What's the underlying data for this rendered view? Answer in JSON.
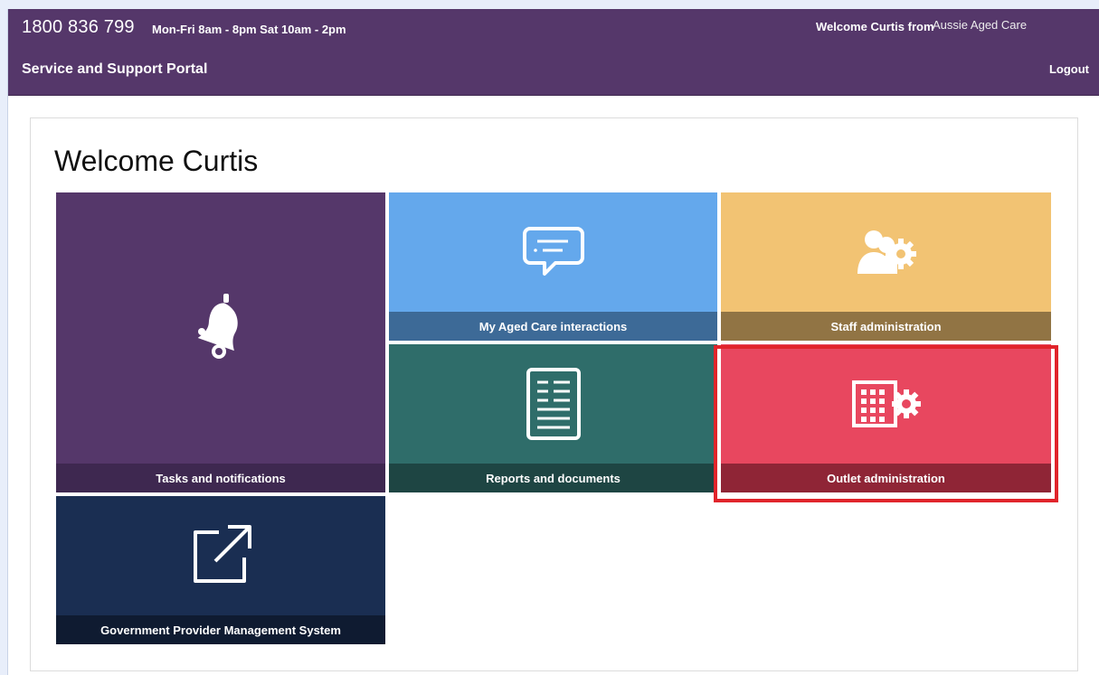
{
  "header": {
    "phone": "1800 836 799",
    "hours": "Mon-Fri 8am - 8pm Sat 10am - 2pm",
    "welcome_prefix": "Welcome Curtis from",
    "org_name": "Aussie Aged Care",
    "portal_title": "Service and Support Portal",
    "logout_label": "Logout"
  },
  "main": {
    "title": "Welcome Curtis",
    "tiles": [
      {
        "label": "Tasks and notifications",
        "icon": "bell-icon",
        "color": "#55376a"
      },
      {
        "label": "My Aged Care interactions",
        "icon": "chat-bubble-icon",
        "color": "#64a8ec"
      },
      {
        "label": "Staff administration",
        "icon": "people-gear-icon",
        "color": "#f2c373"
      },
      {
        "label": "Reports and documents",
        "icon": "document-icon",
        "color": "#2f6d6a"
      },
      {
        "label": "Outlet administration",
        "icon": "building-gear-icon",
        "color": "#e8475f"
      },
      {
        "label": "Government Provider Management System",
        "icon": "external-link-icon",
        "color": "#1a2e52"
      }
    ]
  },
  "colors": {
    "header_bg": "#55376a",
    "highlight": "#e0242b"
  }
}
